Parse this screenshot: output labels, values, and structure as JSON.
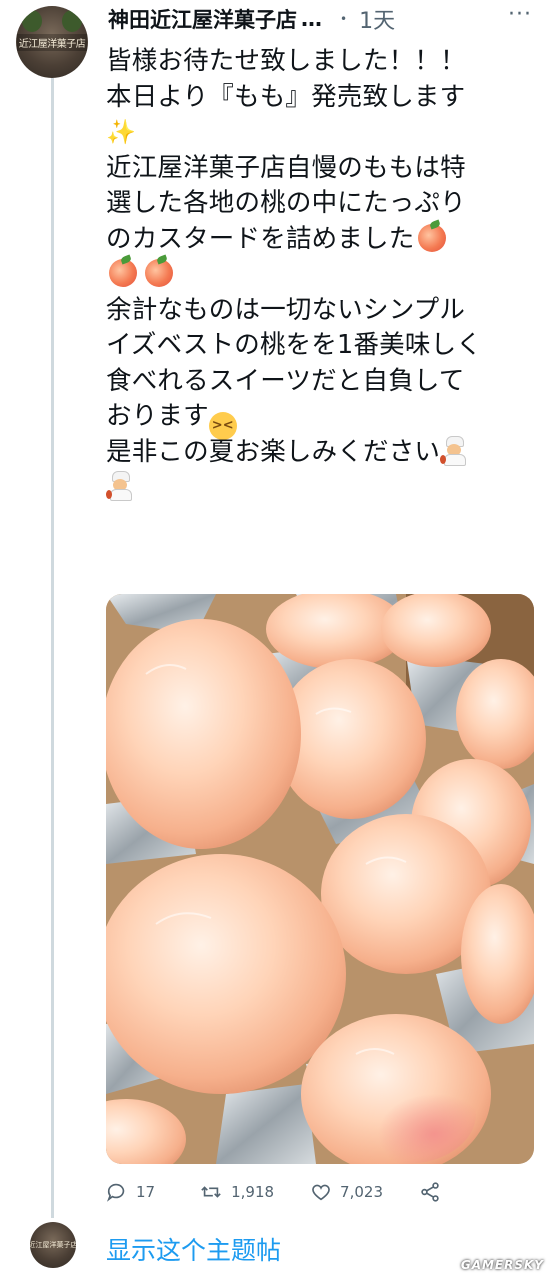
{
  "tweet": {
    "author_name": "神田近江屋洋菓子店",
    "author_name_ellipsis": "…",
    "dot": "•",
    "time": "1天",
    "more": "···",
    "avatar_sign": "近江屋洋菓子店",
    "lines": {
      "l1": "皆様お待たせ致しました！！！",
      "l2": "本日より『もも』発売致します",
      "l4": "近江屋洋菓子店自慢のももは特",
      "l5": "選した各地の桃の中にたっぷり",
      "l6": "のカスタードを詰めました",
      "l8": "余計なものは一切ないシンプル",
      "l9": "イズベストの桃をを1番美味しく",
      "l10": "食べれるスイーツだと自負して",
      "l11": "おります",
      "l12": "是非この夏お楽しみください"
    },
    "emoji": {
      "sparkles": "✨",
      "peach": "peach-emoji",
      "huffing": "face-with-steam-emoji",
      "cook": "woman-cook-emoji"
    },
    "media_icon": "peach-pastries-photo"
  },
  "actions": {
    "reply_count": "17",
    "retweet_count": "1,918",
    "like_count": "7,023",
    "reply_icon": "reply-icon",
    "retweet_icon": "retweet-icon",
    "like_icon": "heart-icon",
    "share_icon": "share-icon"
  },
  "thread": {
    "show_thread_label": "显示这个主题帖",
    "avatar_sign": "近江屋洋菓子店"
  },
  "watermark": "GAMERSKY",
  "colors": {
    "link": "#1d9bf0",
    "muted": "#536471",
    "text": "#0f1419",
    "thread_line": "#cfd9de"
  }
}
